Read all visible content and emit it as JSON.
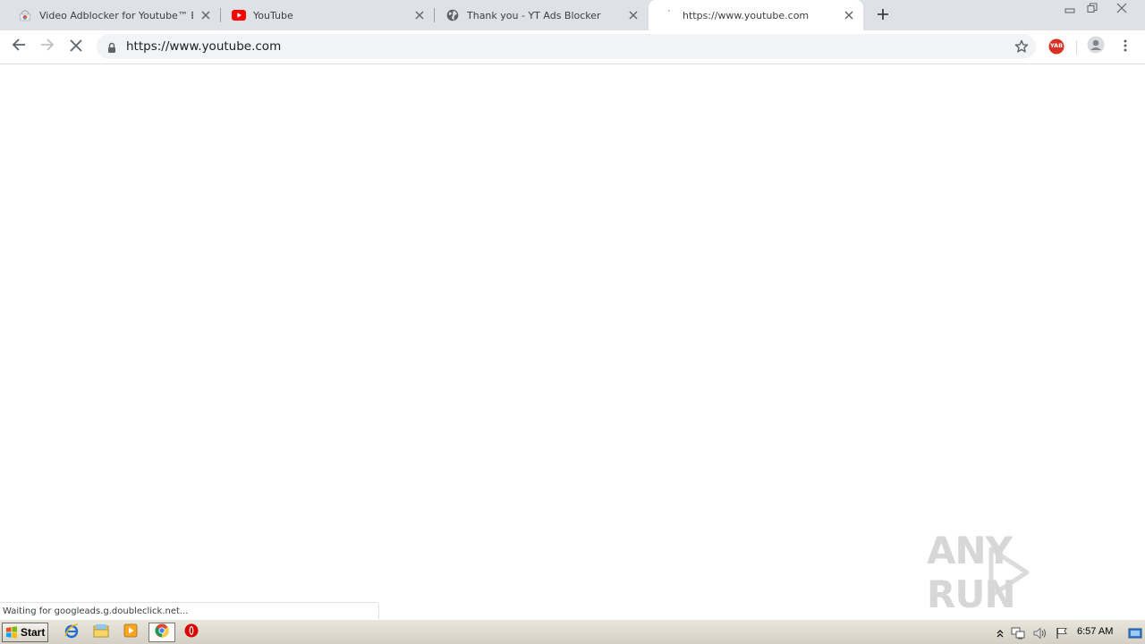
{
  "tabs": [
    {
      "title": "Video Adblocker for Youtube™ Extension",
      "icon": "chrome-webstore-icon"
    },
    {
      "title": "YouTube",
      "icon": "youtube-icon"
    },
    {
      "title": "Thank you - YT Ads Blocker",
      "icon": "globe-icon"
    },
    {
      "title": "https://www.youtube.com",
      "icon": "loading-icon",
      "active": true
    }
  ],
  "toolbar": {
    "url": "https://www.youtube.com",
    "extension_badge": "YAB"
  },
  "status": {
    "text": "Waiting for googleads.g.doubleclick.net..."
  },
  "watermark": {
    "text": "ANY RUN"
  },
  "taskbar": {
    "start_label": "Start",
    "clock": "6:57 AM"
  },
  "colors": {
    "tabstrip_bg": "#dee1e6",
    "omnibox_bg": "#f1f3f4",
    "youtube_red": "#ff0000",
    "yab_red": "#d93025"
  }
}
